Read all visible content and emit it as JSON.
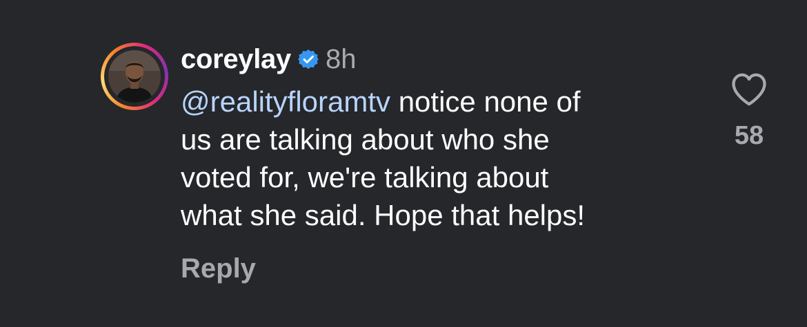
{
  "comment": {
    "username": "coreylay",
    "verified_icon": "verified-badge-icon",
    "timestamp": "8h",
    "mention": "@realityfloramtv",
    "lines": [
      " notice none of",
      "us are talking about who she",
      "voted for, we're talking about",
      "what she said. Hope that helps!"
    ],
    "reply_label": "Reply",
    "like_icon": "heart-outline-icon",
    "like_count": "58"
  },
  "colors": {
    "background": "#25272b",
    "text": "#ffffff",
    "muted": "#a6a9ae",
    "mention": "#b9d4fb",
    "verified": "#3797f0"
  }
}
